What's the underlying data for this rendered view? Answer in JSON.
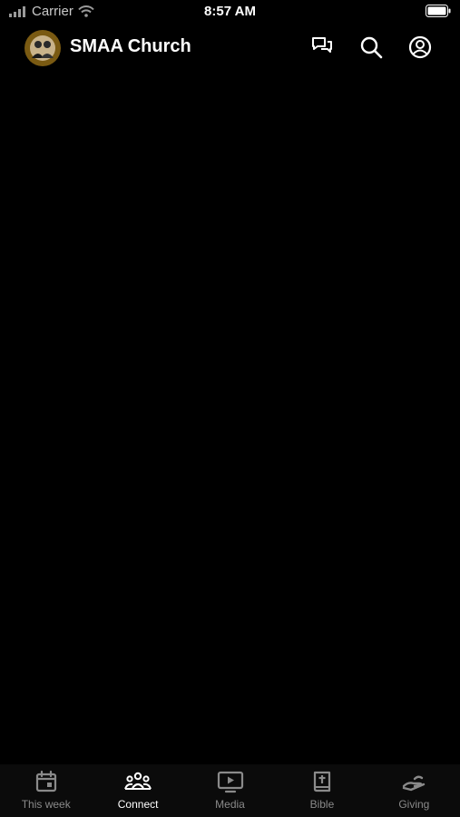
{
  "status_bar": {
    "carrier": "Carrier",
    "time": "8:57 AM"
  },
  "header": {
    "title": "SMAA Church",
    "avatar_color": "#7a5a12",
    "actions": [
      {
        "icon": "chat-icon"
      },
      {
        "icon": "search-icon"
      },
      {
        "icon": "profile-icon"
      }
    ]
  },
  "tabs": [
    {
      "label": "This week",
      "icon": "calendar-icon",
      "active": false
    },
    {
      "label": "Connect",
      "icon": "people-icon",
      "active": true
    },
    {
      "label": "Media",
      "icon": "play-screen-icon",
      "active": false
    },
    {
      "label": "Bible",
      "icon": "bible-icon",
      "active": false
    },
    {
      "label": "Giving",
      "icon": "giving-hand-icon",
      "active": false
    }
  ],
  "colors": {
    "background": "#000000",
    "active_tab": "#ffffff",
    "inactive_tab": "#8a8a8a"
  }
}
